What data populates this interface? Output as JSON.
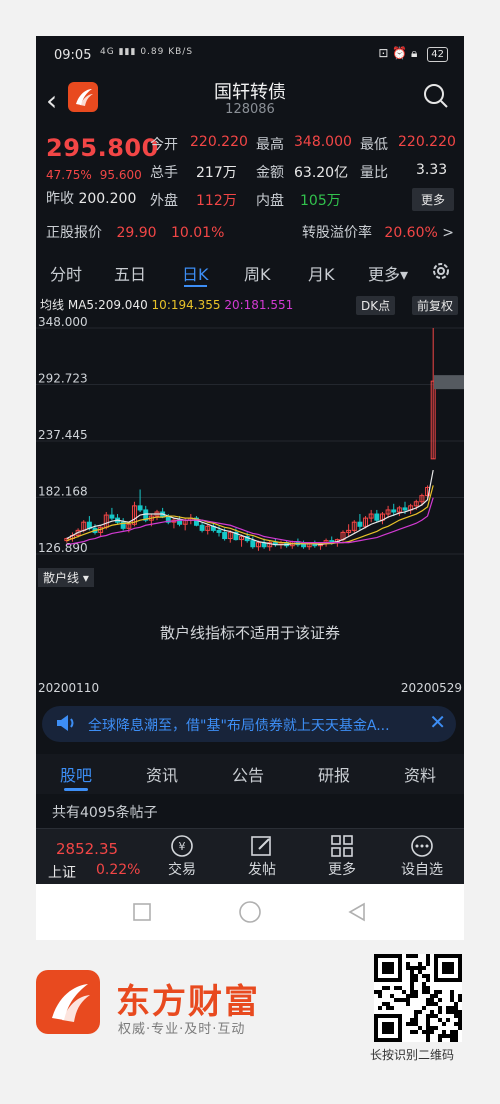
{
  "status_bar": {
    "time": "09:05",
    "signal": "4G",
    "net_speed": "0.89 KB/S",
    "battery": "42"
  },
  "header": {
    "title": "国轩转债",
    "code": "128086"
  },
  "quote": {
    "price": "295.800",
    "change_pct": "47.75%",
    "change_abs": "95.600",
    "prev_close_label": "昨收",
    "prev_close": "200.200",
    "open_label": "今开",
    "open": "220.220",
    "high_label": "最高",
    "high": "348.000",
    "low_label": "最低",
    "low": "220.220",
    "volume_label": "总手",
    "volume": "217万",
    "amount_label": "金额",
    "amount": "63.20亿",
    "vol_ratio_label": "量比",
    "vol_ratio": "3.33",
    "outer_label": "外盘",
    "outer": "112万",
    "inner_label": "内盘",
    "inner": "105万",
    "more_label": "更多",
    "stock_price_label": "正股报价",
    "stock_price": "29.90",
    "stock_pct": "10.01%",
    "premium_label": "转股溢价率",
    "premium": "20.60%",
    "premium_arrow": ">"
  },
  "period_tabs": [
    "分时",
    "五日",
    "日K",
    "周K",
    "月K",
    "更多▾"
  ],
  "active_period_tab": 2,
  "chart_legend": {
    "title": "均线",
    "ma5": "MA5:209.040",
    "ma10": "10:194.355",
    "ma20": "20:181.551",
    "dk_label": "DK点",
    "adj_label": "前复权"
  },
  "colors": {
    "up": "#f24646",
    "down": "#16c8c8",
    "ma5": "#e8e8e8",
    "ma10": "#e8c229",
    "ma20": "#d23ad2",
    "accent": "#3d8ef5"
  },
  "chart_data": {
    "type": "candlestick",
    "y_ticks": [
      "348.000",
      "292.723",
      "237.445",
      "182.168",
      "126.890"
    ],
    "ylim": [
      126.89,
      348.0
    ],
    "x_start": "20200110",
    "x_end": "20200529",
    "candles": [
      [
        140,
        143,
        138,
        142
      ],
      [
        142,
        148,
        139,
        145
      ],
      [
        145,
        152,
        143,
        150
      ],
      [
        150,
        160,
        148,
        158
      ],
      [
        158,
        164,
        150,
        152
      ],
      [
        152,
        156,
        146,
        148
      ],
      [
        148,
        154,
        144,
        153
      ],
      [
        153,
        168,
        151,
        165
      ],
      [
        165,
        172,
        160,
        162
      ],
      [
        162,
        166,
        156,
        158
      ],
      [
        158,
        162,
        150,
        152
      ],
      [
        152,
        158,
        148,
        156
      ],
      [
        156,
        178,
        154,
        174
      ],
      [
        174,
        190,
        168,
        170
      ],
      [
        170,
        174,
        158,
        160
      ],
      [
        160,
        166,
        154,
        164
      ],
      [
        164,
        170,
        160,
        168
      ],
      [
        168,
        172,
        162,
        163
      ],
      [
        163,
        166,
        156,
        158
      ],
      [
        158,
        162,
        152,
        160
      ],
      [
        160,
        164,
        154,
        156
      ],
      [
        156,
        162,
        150,
        160
      ],
      [
        160,
        166,
        156,
        162
      ],
      [
        162,
        164,
        154,
        155
      ],
      [
        155,
        158,
        148,
        150
      ],
      [
        150,
        156,
        146,
        154
      ],
      [
        154,
        158,
        148,
        150
      ],
      [
        150,
        154,
        144,
        148
      ],
      [
        148,
        152,
        140,
        142
      ],
      [
        142,
        150,
        138,
        148
      ],
      [
        148,
        152,
        140,
        141
      ],
      [
        141,
        146,
        134,
        144
      ],
      [
        144,
        148,
        138,
        140
      ],
      [
        140,
        144,
        132,
        134
      ],
      [
        134,
        140,
        130,
        138
      ],
      [
        138,
        142,
        132,
        134
      ],
      [
        134,
        140,
        130,
        138
      ],
      [
        138,
        142,
        134,
        136
      ],
      [
        136,
        140,
        132,
        138
      ],
      [
        138,
        140,
        133,
        135
      ],
      [
        135,
        140,
        132,
        139
      ],
      [
        139,
        142,
        134,
        136
      ],
      [
        136,
        140,
        132,
        134
      ],
      [
        134,
        138,
        131,
        137
      ],
      [
        137,
        140,
        133,
        135
      ],
      [
        135,
        138,
        131,
        137
      ],
      [
        137,
        142,
        134,
        140
      ],
      [
        140,
        144,
        136,
        138
      ],
      [
        138,
        142,
        134,
        141
      ],
      [
        141,
        150,
        139,
        148
      ],
      [
        148,
        156,
        144,
        150
      ],
      [
        150,
        160,
        148,
        158
      ],
      [
        158,
        166,
        150,
        154
      ],
      [
        154,
        164,
        152,
        162
      ],
      [
        162,
        170,
        158,
        166
      ],
      [
        166,
        170,
        158,
        160
      ],
      [
        160,
        168,
        156,
        166
      ],
      [
        166,
        174,
        162,
        170
      ],
      [
        170,
        176,
        164,
        168
      ],
      [
        168,
        174,
        164,
        172
      ],
      [
        172,
        178,
        166,
        170
      ],
      [
        170,
        176,
        166,
        174
      ],
      [
        174,
        180,
        170,
        178
      ],
      [
        178,
        186,
        174,
        184
      ],
      [
        184,
        194,
        180,
        192
      ],
      [
        220,
        348,
        220,
        296
      ]
    ],
    "ma5": [
      142,
      145,
      148,
      150,
      152,
      154,
      155,
      157,
      159,
      160,
      159,
      158,
      161,
      165,
      166,
      166,
      166,
      166,
      164,
      162,
      161,
      160,
      160,
      160,
      158,
      156,
      154,
      152,
      150,
      149,
      147,
      145,
      143,
      141,
      139,
      138,
      137,
      136,
      136,
      136,
      137,
      137,
      137,
      137,
      137,
      136,
      137,
      138,
      139,
      141,
      144,
      147,
      150,
      153,
      156,
      158,
      160,
      163,
      165,
      167,
      168,
      170,
      172,
      175,
      180,
      209
    ],
    "ma10": [
      140,
      142,
      144,
      146,
      148,
      150,
      151,
      153,
      155,
      156,
      157,
      157,
      158,
      160,
      161,
      162,
      163,
      163,
      164,
      164,
      163,
      162,
      162,
      161,
      160,
      158,
      157,
      155,
      153,
      152,
      150,
      148,
      146,
      145,
      143,
      141,
      140,
      139,
      138,
      138,
      137,
      137,
      137,
      137,
      137,
      137,
      137,
      137,
      138,
      138,
      139,
      141,
      143,
      145,
      147,
      149,
      152,
      154,
      157,
      160,
      162,
      164,
      166,
      169,
      173,
      194
    ],
    "ma20": [
      136,
      137,
      138,
      139,
      141,
      142,
      144,
      145,
      147,
      148,
      149,
      150,
      152,
      153,
      155,
      156,
      157,
      158,
      159,
      159,
      160,
      160,
      160,
      160,
      160,
      159,
      158,
      157,
      156,
      155,
      153,
      151,
      149,
      147,
      146,
      144,
      143,
      142,
      141,
      140,
      139,
      139,
      138,
      138,
      138,
      138,
      138,
      138,
      138,
      138,
      138,
      139,
      140,
      141,
      142,
      143,
      145,
      147,
      149,
      151,
      153,
      155,
      157,
      160,
      164,
      182
    ]
  },
  "scatter": {
    "tag": "散户线",
    "message": "散户线指标不适用于该证券"
  },
  "dates": {
    "start": "20200110",
    "end": "20200529"
  },
  "banner": {
    "text": "全球降息潮至，借\"基\"布局债券就上天天基金A..."
  },
  "sub_tabs": [
    "股吧",
    "资讯",
    "公告",
    "研报",
    "资料"
  ],
  "active_sub_tab": 0,
  "posts_text": "共有4095条帖子",
  "bottom_bar": {
    "index_value": "2852.35",
    "index_name": "上证",
    "index_pct": "0.22%",
    "items": [
      "交易",
      "发帖",
      "更多",
      "设自选"
    ]
  },
  "footer": {
    "brand": "东方财富",
    "slogan": "权威·专业·及时·互动",
    "qr_label": "长按识别二维码"
  }
}
